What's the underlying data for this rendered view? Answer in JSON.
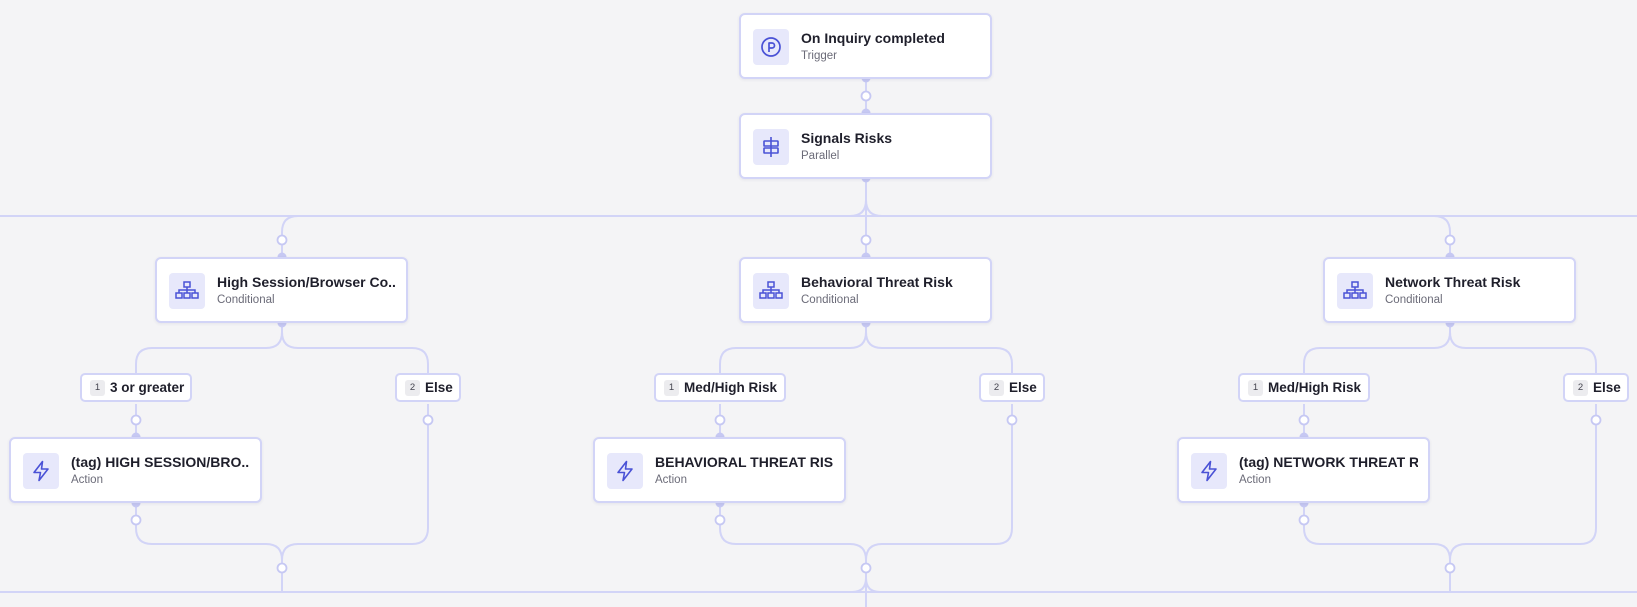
{
  "colors": {
    "accent": "#4a52d6",
    "connector": "#d2d4f7",
    "connector_dot": "#c6c8f3",
    "icon_bg": "#e7e8fb",
    "canvas_bg": "#f4f4f6"
  },
  "nodes": {
    "trigger": {
      "title": "On Inquiry completed",
      "type": "Trigger",
      "icon": "trigger-icon"
    },
    "parallel": {
      "title": "Signals Risks",
      "type": "Parallel",
      "icon": "parallel-icon"
    },
    "cond_session": {
      "title": "High Session/Browser Co...",
      "type": "Conditional",
      "icon": "conditional-tree-icon"
    },
    "cond_behavioral": {
      "title": "Behavioral Threat Risk",
      "type": "Conditional",
      "icon": "conditional-tree-icon"
    },
    "cond_network": {
      "title": "Network Threat Risk",
      "type": "Conditional",
      "icon": "conditional-tree-icon"
    },
    "action_session": {
      "title": "(tag) HIGH SESSION/BRO...",
      "type": "Action",
      "icon": "lightning-icon"
    },
    "action_behavioral": {
      "title": "BEHAVIORAL THREAT RISK",
      "type": "Action",
      "icon": "lightning-icon"
    },
    "action_network": {
      "title": "(tag) NETWORK THREAT R...",
      "type": "Action",
      "icon": "lightning-icon"
    }
  },
  "branches": {
    "session_1": {
      "num": "1",
      "label": "3 or greater"
    },
    "session_2": {
      "num": "2",
      "label": "Else"
    },
    "behavioral_1": {
      "num": "1",
      "label": "Med/High Risk"
    },
    "behavioral_2": {
      "num": "2",
      "label": "Else"
    },
    "network_1": {
      "num": "1",
      "label": "Med/High Risk"
    },
    "network_2": {
      "num": "2",
      "label": "Else"
    }
  }
}
